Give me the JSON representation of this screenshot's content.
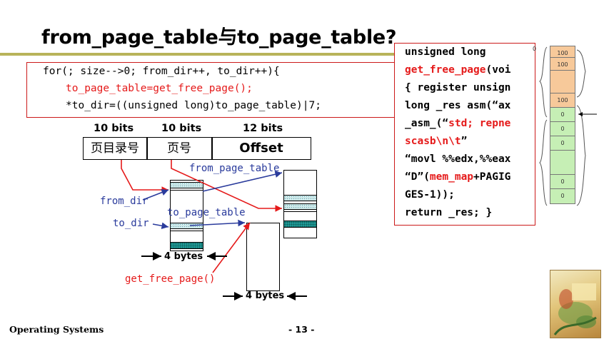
{
  "title": "from_page_table与to_page_table?",
  "code": {
    "line1": "for(; size-->0; from_dir++, to_dir++){",
    "line2": "to_page_table=get_free_page();",
    "line3": "*to_dir=((unsigned long)to_page_table)|7;"
  },
  "address_format": {
    "bits": [
      "10 bits",
      "10 bits",
      "12 bits"
    ],
    "fields": [
      "页目录号",
      "页号",
      "Offset"
    ]
  },
  "diagram": {
    "from_page_table_label": "from_page_table",
    "from_dir_label": "from_dir",
    "to_page_table_label": "to_page_table",
    "to_dir_label": "to_dir",
    "get_free_page_label": "get_free_page()",
    "bytes_label_1": "4 bytes",
    "bytes_label_2": "4 bytes"
  },
  "popup": {
    "l1": "unsigned long",
    "l2a": "get_free_page",
    "l2b": "(voi",
    "l3": "{ register unsign",
    "l4": "long _res asm(“ax",
    "l5a": "_asm_(“",
    "l5b": "std; repne",
    "l6a": "scasb\\n\\t",
    "l6b": "”",
    "l7": "“movl %%edx,%%eax",
    "l8a": "“D”(",
    "l8b": "mem_map",
    "l8c": "+PAGIG",
    "l9": "GES-1));",
    "l10": "return _res; }"
  },
  "memory": {
    "zero_label": "0",
    "orange_cells": [
      "100",
      "100",
      "100"
    ],
    "green_cells": [
      "0",
      "0",
      "0",
      "0",
      "0"
    ]
  },
  "footer": {
    "course": "Operating Systems",
    "page": "- 13 -"
  },
  "colors": {
    "accent_red": "#e51a1a",
    "label_blue": "#2a3b9c",
    "title_rule": "#b8b35a"
  }
}
